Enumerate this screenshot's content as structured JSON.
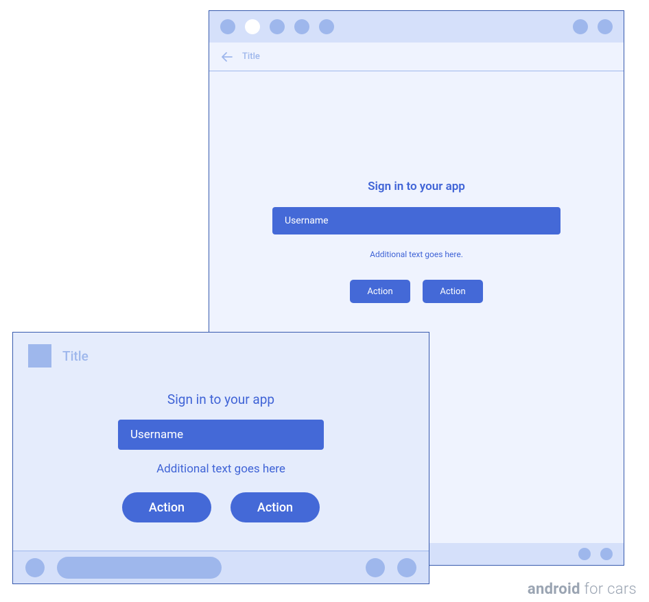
{
  "large_device": {
    "header": {
      "title": "Title"
    },
    "signin": {
      "heading": "Sign in to your app",
      "username_placeholder": "Username",
      "additional_text": "Additional text goes here.",
      "button1_label": "Action",
      "button2_label": "Action"
    }
  },
  "small_device": {
    "header": {
      "title": "Title"
    },
    "signin": {
      "heading": "Sign in to your app",
      "username_placeholder": "Username",
      "additional_text": "Additional text goes here",
      "button1_label": "Action",
      "button2_label": "Action"
    }
  },
  "brand": {
    "bold": "android",
    "thin": " for cars"
  }
}
